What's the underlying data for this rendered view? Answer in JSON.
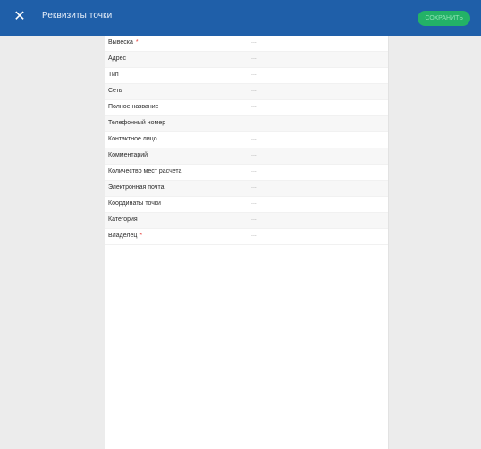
{
  "header": {
    "title": "Реквизиты точки",
    "close_icon": "close-icon",
    "save_label": "СОХРАНИТЬ"
  },
  "colors": {
    "header_bg": "#1f5fa9",
    "save_bg": "#23b267",
    "required_marker": "#e53935"
  },
  "form": {
    "rows": [
      {
        "label": "Вывеска",
        "required": "*",
        "value": "..."
      },
      {
        "label": "Адрес",
        "required": "",
        "value": "..."
      },
      {
        "label": "Тип",
        "required": "",
        "value": "..."
      },
      {
        "label": "Сеть",
        "required": "",
        "value": "..."
      },
      {
        "label": "Полное название",
        "required": "",
        "value": "..."
      },
      {
        "label": "Телефонный номер",
        "required": "",
        "value": "..."
      },
      {
        "label": "Контактное лицо",
        "required": "",
        "value": "..."
      },
      {
        "label": "Комментарий",
        "required": "",
        "value": "..."
      },
      {
        "label": "Количество мест расчета",
        "required": "",
        "value": "..."
      },
      {
        "label": "Электронная почта",
        "required": "",
        "value": "..."
      },
      {
        "label": "Координаты точки",
        "required": "",
        "value": "..."
      },
      {
        "label": "Категория",
        "required": "",
        "value": "..."
      },
      {
        "label": "Владелец",
        "required": "*",
        "value": "..."
      }
    ]
  }
}
